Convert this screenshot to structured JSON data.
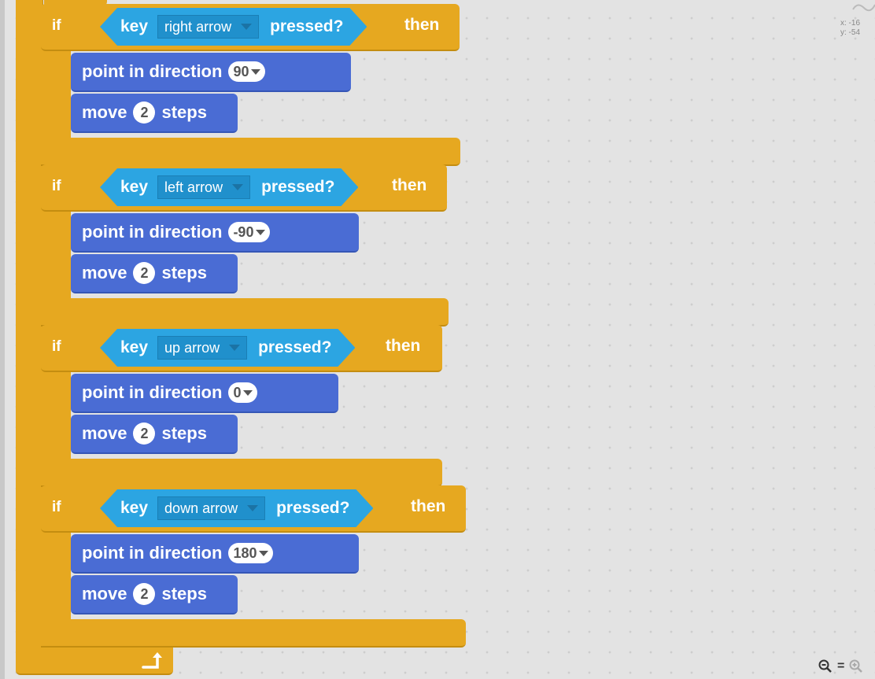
{
  "workspace": {
    "coords": {
      "x_label": "x: -16",
      "y_label": "y: -54"
    }
  },
  "if_blocks": [
    {
      "if_label": "if",
      "key_prefix": "key",
      "key_value": "right arrow",
      "pressed_label": "pressed?",
      "then_label": "then",
      "direction_label": "point in direction",
      "direction_value": "90",
      "move_label": "move",
      "steps_value": "2",
      "steps_label": "steps"
    },
    {
      "if_label": "if",
      "key_prefix": "key",
      "key_value": "left arrow",
      "pressed_label": "pressed?",
      "then_label": "then",
      "direction_label": "point in direction",
      "direction_value": "-90",
      "move_label": "move",
      "steps_value": "2",
      "steps_label": "steps"
    },
    {
      "if_label": "if",
      "key_prefix": "key",
      "key_value": "up arrow",
      "pressed_label": "pressed?",
      "then_label": "then",
      "direction_label": "point in direction",
      "direction_value": "0",
      "move_label": "move",
      "steps_value": "2",
      "steps_label": "steps"
    },
    {
      "if_label": "if",
      "key_prefix": "key",
      "key_value": "down arrow",
      "pressed_label": "pressed?",
      "then_label": "then",
      "direction_label": "point in direction",
      "direction_value": "180",
      "move_label": "move",
      "steps_value": "2",
      "steps_label": "steps"
    }
  ],
  "zoom": {
    "zoom_out": "−",
    "reset": "=",
    "zoom_in": "+"
  },
  "icons": {
    "loop": "loop-arrow-icon",
    "zoom_out": "zoom-out-icon",
    "zoom_reset": "zoom-reset-icon",
    "zoom_in": "zoom-in-icon"
  },
  "colors": {
    "control": "#e6a820",
    "sensing": "#2ca5e2",
    "motion": "#4a6cd4",
    "workspace": "#e3e3e3"
  }
}
